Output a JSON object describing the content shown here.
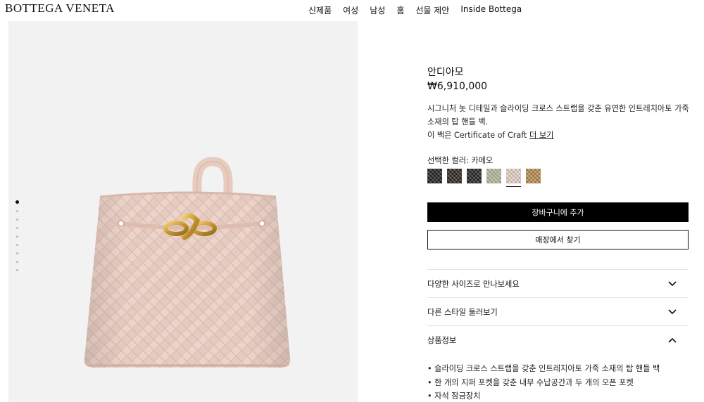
{
  "header": {
    "logo": "BOTTEGA VENETA",
    "nav": [
      "신제품",
      "여성",
      "남성",
      "홈",
      "선물 제안",
      "Inside Bottega"
    ]
  },
  "gallery": {
    "image_count": 9,
    "active_index": 1,
    "bag_color": "#ecd4ca"
  },
  "product": {
    "title": "안디아모",
    "price": "₩6,910,000",
    "description": "시그니처 놋 디테일과 슬라이딩 크로스 스트랩을 갖춘 유연한 인트레치아토 가죽 소재의 탑 핸들 백.",
    "certificate_text": "이 백은 Certificate of Craft",
    "certificate_link": "더 보기",
    "color_label": "선택한 컬러: 카메오",
    "swatches": [
      {
        "color": "#1e1e1e",
        "selected": false
      },
      {
        "color": "#2e2420",
        "selected": false
      },
      {
        "color": "#232323",
        "selected": false
      },
      {
        "color": "#b8bc9b",
        "selected": false
      },
      {
        "color": "#ecd4ca",
        "selected": true
      },
      {
        "color": "#b98c4e",
        "selected": false
      }
    ],
    "add_to_cart": "장바구니에 추가",
    "find_store": "매장에서 찾기",
    "accordions": [
      {
        "label": "다양한 사이즈로 만나보세요",
        "expanded": false
      },
      {
        "label": "다른 스타일 둘러보기",
        "expanded": false
      },
      {
        "label": "상품정보",
        "expanded": true
      }
    ],
    "info_items": [
      "• 슬라이딩 크로스 스트랩을 갖춘 인트레치아토 가죽 소재의 탑 핸들 백",
      "• 한 개의 지퍼 포켓을 갖춘 내부 수납공간과 두 개의 오픈 포켓",
      "• 자석 잠금장치"
    ]
  }
}
